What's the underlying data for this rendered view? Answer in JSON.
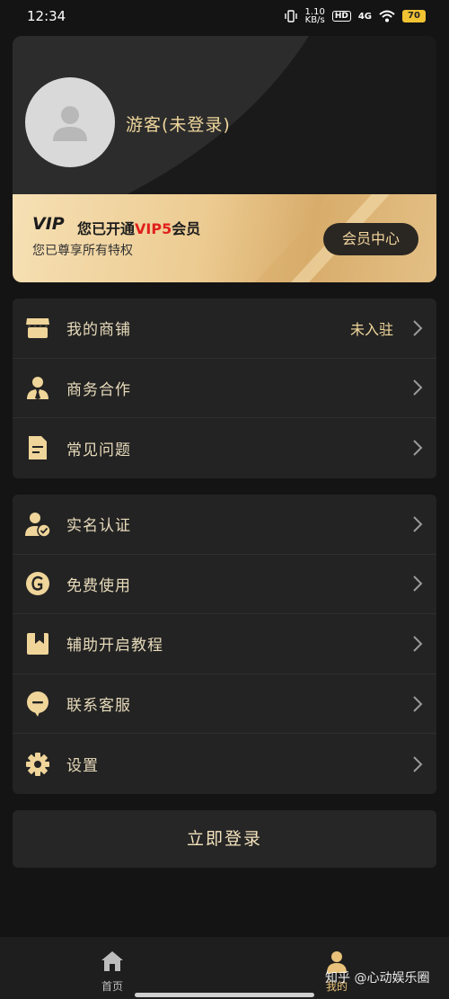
{
  "status_bar": {
    "time": "12:34",
    "network_speed_top": "1.10",
    "network_speed_bottom": "KB/s",
    "hd": "HD",
    "signal": "4G",
    "battery": "70"
  },
  "profile": {
    "username": "游客(未登录)",
    "vip_tag": "VIP",
    "vip_title_prefix": "您已开通",
    "vip_title_level": "VIP5",
    "vip_title_suffix": "会员",
    "vip_subtitle": "您已尊享所有特权",
    "member_center_button": "会员中心"
  },
  "menu_group_1": [
    {
      "label": "我的商铺",
      "status": "未入驻",
      "icon": "shop-icon"
    },
    {
      "label": "商务合作",
      "status": "",
      "icon": "business-person-icon"
    },
    {
      "label": "常见问题",
      "status": "",
      "icon": "document-icon"
    }
  ],
  "menu_group_2": [
    {
      "label": "实名认证",
      "icon": "verified-user-icon"
    },
    {
      "label": "免费使用",
      "icon": "g-circle-icon"
    },
    {
      "label": "辅助开启教程",
      "icon": "bookmark-icon"
    },
    {
      "label": "联系客服",
      "icon": "chat-bubble-icon"
    },
    {
      "label": "设置",
      "icon": "gear-icon"
    }
  ],
  "login_button": "立即登录",
  "bottom_nav": {
    "home_label": "首页",
    "mine_label": "我的"
  },
  "watermark": "知乎 @心动娱乐圈",
  "colors": {
    "background": "#141414",
    "card": "#232323",
    "gold": "#f1d79b",
    "vip_red": "#e0201c"
  }
}
